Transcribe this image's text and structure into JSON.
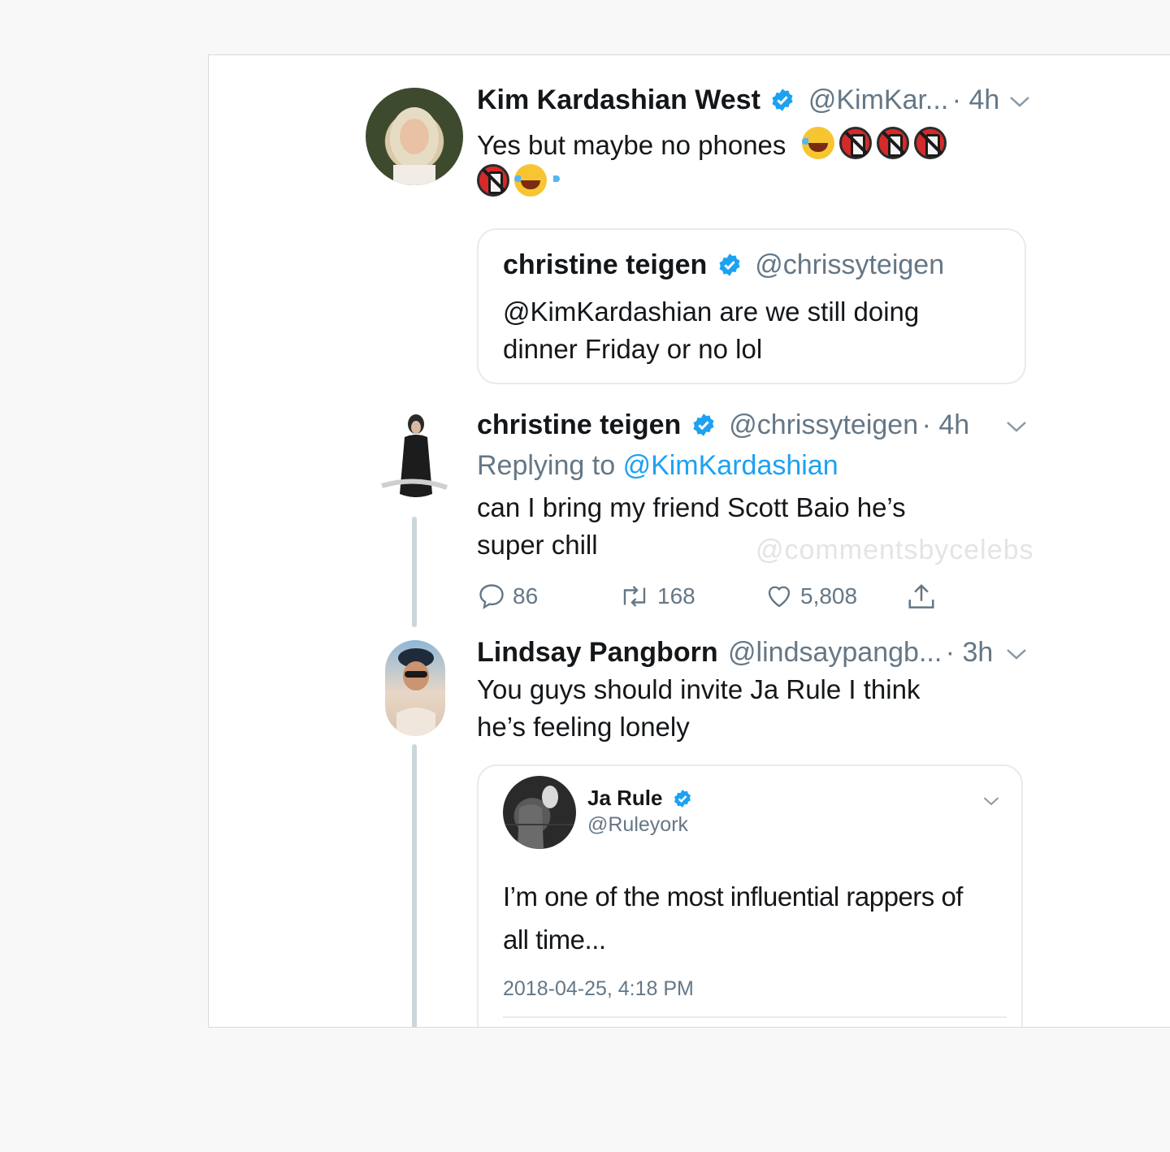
{
  "tweet1": {
    "name": "Kim Kardashian West",
    "handle": "@KimKar...",
    "time": "· 4h",
    "text": "Yes but maybe no phones",
    "quoted": {
      "name": "christine teigen",
      "handle": "@chrissyteigen",
      "text_line1": "@KimKardashian are we still doing",
      "text_line2": "dinner Friday or no lol"
    }
  },
  "tweet2": {
    "name": "christine teigen",
    "handle": "@chrissyteigen",
    "time": "· 4h",
    "replying_prefix": "Replying to",
    "replying_to": "@KimKardashian",
    "text_line1": "can I bring my friend Scott Baio he’s",
    "text_line2": "super chill",
    "watermark": "@commentsbycelebs",
    "actions": {
      "replies": "86",
      "retweets": "168",
      "likes": "5,808"
    }
  },
  "tweet3": {
    "name": "Lindsay Pangborn",
    "handle": "@lindsaypangb...",
    "time": "· 3h",
    "text_line1": "You guys should invite Ja Rule I think",
    "text_line2": "he’s feeling lonely",
    "embedded": {
      "name": "Ja Rule",
      "handle": "@Ruleyork",
      "text_line1": "I’m one of the most influential rappers of",
      "text_line2": "all time...",
      "timestamp": "2018-04-25, 4:18 PM"
    }
  },
  "colors": {
    "accent": "#1da1f2",
    "verified": "#1da1f2",
    "muted": "#657786"
  }
}
